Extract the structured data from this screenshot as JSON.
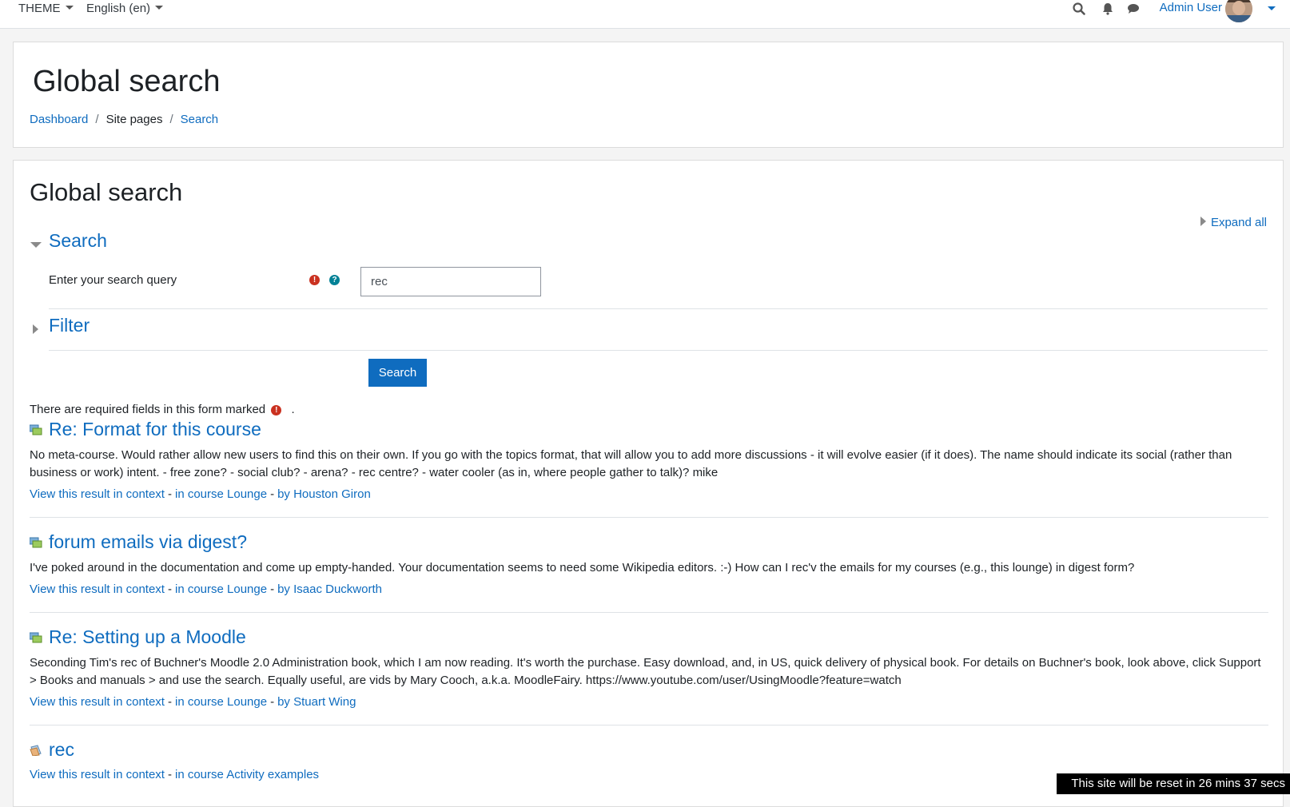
{
  "navbar": {
    "theme_label": "THEME",
    "language_label": "English (en)",
    "icons": [
      "search-icon",
      "bell-icon",
      "chat-icon"
    ],
    "user_name": "Admin User"
  },
  "header": {
    "title": "Global search",
    "breadcrumb": [
      "Dashboard",
      "Site pages",
      "Search"
    ]
  },
  "main": {
    "title": "Global search",
    "expand_all": "Expand all",
    "search_section": "Search",
    "query_label": "Enter your search query",
    "query_value": "rec",
    "filter_section": "Filter",
    "submit_label": "Search",
    "required_note": "There are required fields in this form marked",
    "required_note_end": "."
  },
  "results": [
    {
      "title": "Re: Format for this course",
      "snippet": "No meta-course. Would rather allow new users to find this on their own. If you go with the topics format, that will allow you to add more discussions - it will evolve easier (if it does). The name should indicate its social (rather than business or work) intent. - free zone? - social club? - arena? - rec centre? - water cooler (as in, where people gather to talk)? mike",
      "context": "View this result in context",
      "course": "in course Lounge",
      "author": "by Houston Giron"
    },
    {
      "title": "forum emails via digest?",
      "snippet": "I've poked around in the documentation and come up empty-handed. Your documentation seems to need some Wikipedia editors. :-) How can I rec'v the emails for my courses (e.g., this lounge) in digest form?",
      "context": "View this result in context",
      "course": "in course Lounge",
      "author": "by Isaac Duckworth"
    },
    {
      "title": "Re: Setting up a Moodle",
      "snippet": "Seconding Tim's rec of Buchner's Moodle 2.0 Administration book, which I am now reading. It's worth the purchase. Easy download, and, in US, quick delivery of physical book. For details on Buchner's book, look above, click Support > Books and manuals > and use the search. Equally useful, are vids by Mary Cooch, a.k.a. MoodleFairy. https://www.youtube.com/user/UsingMoodle?feature=watch",
      "context": "View this result in context",
      "course": "in course Lounge",
      "author": "by Stuart Wing"
    },
    {
      "title": "rec",
      "context": "View this result in context",
      "course": "in course Activity examples"
    }
  ],
  "reset_notice": "This site will be reset in 26 mins 37 secs",
  "colors": {
    "link": "#0f6cbf",
    "required": "#ca3120",
    "help": "#008196"
  }
}
